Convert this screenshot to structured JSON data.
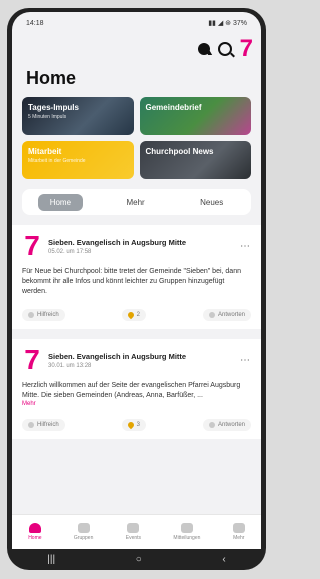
{
  "status": {
    "time": "14:18",
    "right": "▮▮ ◢ ⊛ 37%"
  },
  "header": {
    "title": "Home",
    "logo": "7"
  },
  "tiles": [
    {
      "title": "Tages-Impuls",
      "subtitle": "5 Minuten Impuls"
    },
    {
      "title": "Gemeindebrief",
      "subtitle": ""
    },
    {
      "title": "Mitarbeit",
      "subtitle": "Mitarbeit in der Gemeinde"
    },
    {
      "title": "Churchpool News",
      "subtitle": ""
    }
  ],
  "tabs": [
    "Home",
    "Mehr",
    "Neues"
  ],
  "posts": [
    {
      "title": "Sieben. Evangelisch in Augsburg Mitte",
      "time": "05.02. um 17:58",
      "body": "Für Neue bei Churchpool: bitte tretet der Gemeinde \"Sieben\" bei, dann bekommt ihr alle Infos und könnt leichter zu Gruppen hinzugefügt werden.",
      "link": "",
      "helpful": "Hilfreich",
      "count": "2",
      "reply": "Antworten"
    },
    {
      "title": "Sieben. Evangelisch in Augsburg Mitte",
      "time": "30.01. um 13:28",
      "body": "Herzlich willkommen auf der Seite der evangelischen Pfarrei Augsburg Mitte. Die sieben Gemeinden (Andreas, Anna, Barfüßer, ...",
      "link": "Mehr",
      "helpful": "Hilfreich",
      "count": "3",
      "reply": "Antworten"
    }
  ],
  "bottom_nav": [
    "Home",
    "Gruppen",
    "Events",
    "Mitteilungen",
    "Mehr"
  ]
}
